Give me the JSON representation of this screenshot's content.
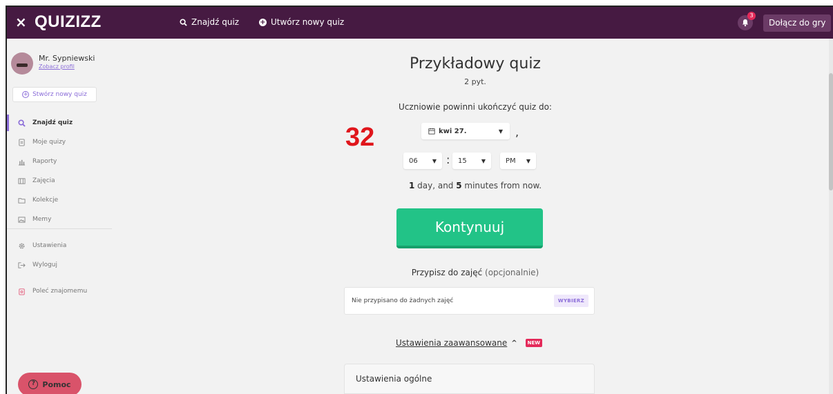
{
  "topbar": {
    "close_glyph": "×",
    "logo": "QUIZIZZ",
    "find_quiz": "Znajdź quiz",
    "create_quiz": "Utwórz nowy quiz",
    "notification_count": "3",
    "join_game": "Dołącz do gry"
  },
  "sidebar": {
    "user_name": "Mr. Sypniewski",
    "view_profile": "Zobacz profil",
    "create_quiz": "Stwórz nowy quiz",
    "items": [
      {
        "label": "Znajdź quiz",
        "icon": "search-icon"
      },
      {
        "label": "Moje quizy",
        "icon": "document-icon"
      },
      {
        "label": "Raporty",
        "icon": "bar-chart-icon"
      },
      {
        "label": "Zajęcia",
        "icon": "class-icon"
      },
      {
        "label": "Kolekcje",
        "icon": "folder-icon"
      },
      {
        "label": "Memy",
        "icon": "image-icon"
      }
    ],
    "settings": "Ustawienia",
    "logout": "Wyloguj",
    "refer": "Poleć znajomemu",
    "help": "Pomoc"
  },
  "main": {
    "overlay_number": "32",
    "title": "Przykładowy quiz",
    "question_count": "2 pyt.",
    "complete_label": "Uczniowie powinni ukończyć quiz do:",
    "date_value": "kwi 27.",
    "hour": "06",
    "minute": "15",
    "ampm": "PM",
    "relative_days": "1",
    "relative_mid": " day, and ",
    "relative_minutes": "5",
    "relative_end": " minutes from now.",
    "continue": "Kontynuuj",
    "assign_label": "Przypisz do zajęć",
    "assign_optional": "(opcjonalnie)",
    "assign_value": "Nie przypisano do żadnych zajęć",
    "pick": "WYBIERZ",
    "advanced": "Ustawienia zaawansowane",
    "new_badge": "NEW",
    "general_settings": "Ustawienia ogólne"
  },
  "colors": {
    "topbar": "#461a42",
    "accent": "#8a6cd8",
    "continue": "#22c387",
    "help": "#d9536a",
    "overlay": "#e0161c"
  }
}
